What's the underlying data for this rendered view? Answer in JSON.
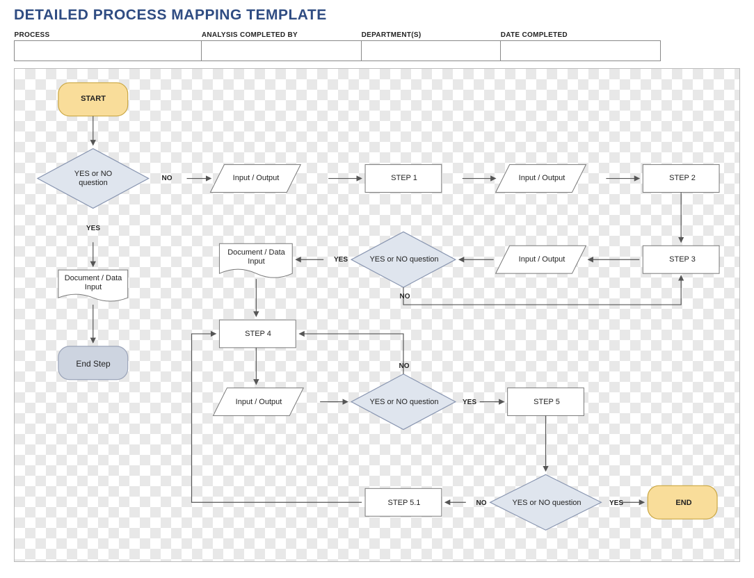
{
  "title": "DETAILED PROCESS MAPPING TEMPLATE",
  "meta": {
    "headers": [
      "PROCESS",
      "ANALYSIS COMPLETED BY",
      "DEPARTMENT(S)",
      "DATE COMPLETED"
    ],
    "values": [
      "",
      "",
      "",
      ""
    ]
  },
  "nodes": {
    "start": "START",
    "q1": "YES or NO question",
    "doc1": "Document / Data Input",
    "endstep": "End Step",
    "io1": "Input / Output",
    "step1": "STEP 1",
    "io2": "Input / Output",
    "step2": "STEP 2",
    "step3": "STEP 3",
    "io3": "Input / Output",
    "q2": "YES or NO question",
    "doc2": "Document / Data Input",
    "step4": "STEP 4",
    "io4": "Input / Output",
    "q3": "YES or NO question",
    "step5": "STEP 5",
    "q4": "YES or NO question",
    "step51": "STEP 5.1",
    "end": "END"
  },
  "edgeLabels": {
    "q1_yes": "YES",
    "q1_no": "NO",
    "q2_yes": "YES",
    "q2_no": "NO",
    "q3_yes": "YES",
    "q3_no": "NO",
    "q4_yes": "YES",
    "q4_no": "NO"
  },
  "colors": {
    "terminator": "#f9dd9a",
    "terminatorStroke": "#c9a642",
    "decisionFill": "#dfe5ee",
    "decisionStroke": "#8895b0",
    "endStepFill": "#cdd4e0",
    "endStepStroke": "#9aa3b8",
    "boxFill": "#ffffff",
    "boxStroke": "#777777",
    "arrow": "#555555",
    "titleColor": "#2f4c82"
  }
}
